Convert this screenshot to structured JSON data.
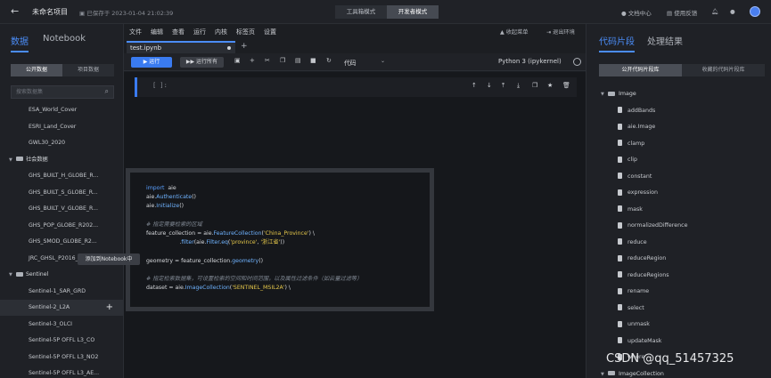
{
  "topbar": {
    "back_icon": "arrow-left-icon",
    "project_title": "未命名项目",
    "saved_text": "已保存于 2023-01-04 21:02:39",
    "modes": [
      "工具箱模式",
      "开发者模式"
    ],
    "active_mode": "开发者模式",
    "doc_center": "文档中心",
    "feedback": "使用反馈"
  },
  "left": {
    "tabs": [
      "数据",
      "Notebook"
    ],
    "subtabs": [
      "公开数据",
      "项目数据"
    ],
    "search_placeholder": "搜索数据集",
    "items": [
      {
        "type": "item",
        "label": "ESA_World_Cover"
      },
      {
        "type": "item",
        "label": "ESRI_Land_Cover"
      },
      {
        "type": "item",
        "label": "GWL30_2020"
      },
      {
        "type": "category",
        "label": "社会数据"
      },
      {
        "type": "item",
        "label": "GHS_BUILT_H_GLOBE_R..."
      },
      {
        "type": "item",
        "label": "GHS_BUILT_S_GLOBE_R..."
      },
      {
        "type": "item",
        "label": "GHS_BUILT_V_GLOBE_R..."
      },
      {
        "type": "item",
        "label": "GHS_POP_GLOBE_R202..."
      },
      {
        "type": "item",
        "label": "GHS_SMOD_GLOBE_R2..."
      },
      {
        "type": "item",
        "label": "JRC_GHSL_P2016_BUILT..."
      },
      {
        "type": "category",
        "label": "Sentinel"
      },
      {
        "type": "item",
        "label": "Sentinel-1_SAR_GRD"
      },
      {
        "type": "item",
        "label": "Sentinel-2_L2A",
        "highlight": true
      },
      {
        "type": "item",
        "label": "Sentinel-3_OLCI"
      },
      {
        "type": "item",
        "label": "Sentinel-5P OFFL L3_CO"
      },
      {
        "type": "item",
        "label": "Sentinel-5P OFFL L3_NO2"
      },
      {
        "type": "item",
        "label": "Sentinel-5P OFFL L3_AE..."
      }
    ],
    "tooltip": "添加到Notebook中"
  },
  "menu": {
    "items": [
      "文件",
      "编辑",
      "查看",
      "运行",
      "内核",
      "标签页",
      "设置"
    ],
    "collapse_menu": "收起菜单",
    "exit_env": "退出环境"
  },
  "notebook": {
    "file_tab": "test.ipynb",
    "run_label": "▶ 运行",
    "run_all_label": "▶▶ 运行所有",
    "cell_type": "代码",
    "kernel": "Python 3 (ipykernel)",
    "cell_prompt": "[ ]:"
  },
  "code": {
    "lines": [
      [
        [
          "kw",
          "import"
        ],
        [
          "",
          "  aie"
        ]
      ],
      [
        [
          "",
          "aie."
        ],
        [
          "fn",
          "Authenticate"
        ],
        [
          "",
          "()"
        ]
      ],
      [
        [
          "",
          "aie."
        ],
        [
          "fn",
          "Initialize"
        ],
        [
          "",
          "()"
        ]
      ],
      [
        [
          "",
          ""
        ]
      ],
      [
        [
          "cm",
          "# 指定需要检索的区域"
        ]
      ],
      [
        [
          "",
          "feature_collection = aie."
        ],
        [
          "fn",
          "FeatureCollection"
        ],
        [
          "",
          "("
        ],
        [
          "str",
          "'China_Province'"
        ],
        [
          "",
          ") \\"
        ]
      ],
      [
        [
          "",
          "                   ."
        ],
        [
          "fn",
          "filter"
        ],
        [
          "",
          "(aie."
        ],
        [
          "fn",
          "Filter"
        ],
        [
          "",
          "."
        ],
        [
          "fn",
          "eq"
        ],
        [
          "",
          "("
        ],
        [
          "str",
          "'province'"
        ],
        [
          "",
          ", "
        ],
        [
          "str",
          "'浙江省'"
        ],
        [
          "",
          "))"
        ]
      ],
      [
        [
          "",
          ""
        ]
      ],
      [
        [
          "",
          "geometry = feature_collection."
        ],
        [
          "fn",
          "geometry"
        ],
        [
          "",
          "()"
        ]
      ],
      [
        [
          "",
          ""
        ]
      ],
      [
        [
          "cm",
          "# 指定检索数据集，可设置检索的空间和时间范围，以及属性过滤条件（如云量过滤等）"
        ]
      ],
      [
        [
          "",
          "dataset = aie."
        ],
        [
          "fn",
          "ImageCollection"
        ],
        [
          "",
          "("
        ],
        [
          "str",
          "'SENTINEL_MSIL2A'"
        ],
        [
          "",
          ") \\"
        ]
      ]
    ]
  },
  "right": {
    "tabs": [
      "代码片段",
      "处理结果"
    ],
    "subtabs": [
      "公开代码片段库",
      "收藏的代码片段库"
    ],
    "items": [
      {
        "type": "category",
        "label": "Image"
      },
      {
        "type": "leaf",
        "label": "addBands"
      },
      {
        "type": "leaf",
        "label": "aie.Image"
      },
      {
        "type": "leaf",
        "label": "clamp"
      },
      {
        "type": "leaf",
        "label": "clip"
      },
      {
        "type": "leaf",
        "label": "constant"
      },
      {
        "type": "leaf",
        "label": "expression"
      },
      {
        "type": "leaf",
        "label": "mask"
      },
      {
        "type": "leaf",
        "label": "normalizedDifference"
      },
      {
        "type": "leaf",
        "label": "reduce"
      },
      {
        "type": "leaf",
        "label": "reduceRegion"
      },
      {
        "type": "leaf",
        "label": "reduceRegions"
      },
      {
        "type": "leaf",
        "label": "rename"
      },
      {
        "type": "leaf",
        "label": "select"
      },
      {
        "type": "leaf",
        "label": "unmask"
      },
      {
        "type": "leaf",
        "label": "updateMask"
      },
      {
        "type": "leaf",
        "label": "where"
      },
      {
        "type": "category",
        "label": "ImageCollection"
      }
    ]
  },
  "watermark": "CSDN @qq_51457325"
}
